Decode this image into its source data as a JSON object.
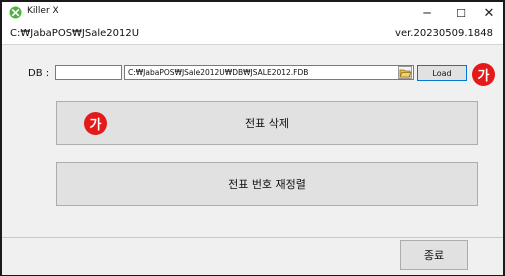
{
  "window": {
    "title": "Killer X",
    "minimize_glyph": "─",
    "maximize_glyph": "☐",
    "close_glyph": "✕"
  },
  "pathbar": {
    "path": "C:₩JabaPOS₩JSale2012U",
    "version": "ver.20230509.1848"
  },
  "db": {
    "label": "DB :",
    "input_short": "",
    "input_path": "C:₩JabaPOS₩JSale2012U₩DB₩JSALE2012.FDB",
    "load_label": "Load"
  },
  "badges": {
    "load": "가",
    "delete": "가"
  },
  "actions": {
    "delete_label": "전표 삭제",
    "renumber_label": "전표 번호 재정렬"
  },
  "footer": {
    "exit_label": "종료"
  },
  "colors": {
    "badge": "#e3191a",
    "focus_border": "#0078d7",
    "button_face": "#e1e1e1"
  },
  "icons": [
    "xbox-app-icon",
    "folder-icon"
  ]
}
